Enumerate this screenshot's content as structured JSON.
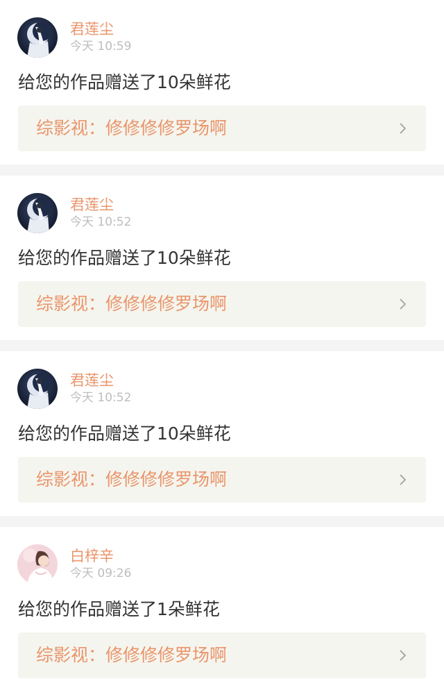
{
  "colors": {
    "accent": "#e9956a",
    "time_gray": "#bdbdbd",
    "text_dark": "#333333",
    "link_bg": "#f5f5ef",
    "separator": "#f4f4f4"
  },
  "notifications": [
    {
      "user": "君莲尘",
      "time": "今天 10:59",
      "message": "给您的作品赠送了10朵鲜花",
      "work_title": "综影视：修修修修罗场啊",
      "avatar": "dark-moon-avatar"
    },
    {
      "user": "君莲尘",
      "time": "今天 10:52",
      "message": "给您的作品赠送了10朵鲜花",
      "work_title": "综影视：修修修修罗场啊",
      "avatar": "dark-moon-avatar"
    },
    {
      "user": "君莲尘",
      "time": "今天 10:52",
      "message": "给您的作品赠送了10朵鲜花",
      "work_title": "综影视：修修修修罗场啊",
      "avatar": "dark-moon-avatar"
    },
    {
      "user": "白梓辛",
      "time": "今天 09:26",
      "message": "给您的作品赠送了1朵鲜花",
      "work_title": "综影视：修修修修罗场啊",
      "avatar": "pink-portrait-avatar"
    }
  ],
  "icons": {
    "chevron": "chevron-right-icon"
  }
}
